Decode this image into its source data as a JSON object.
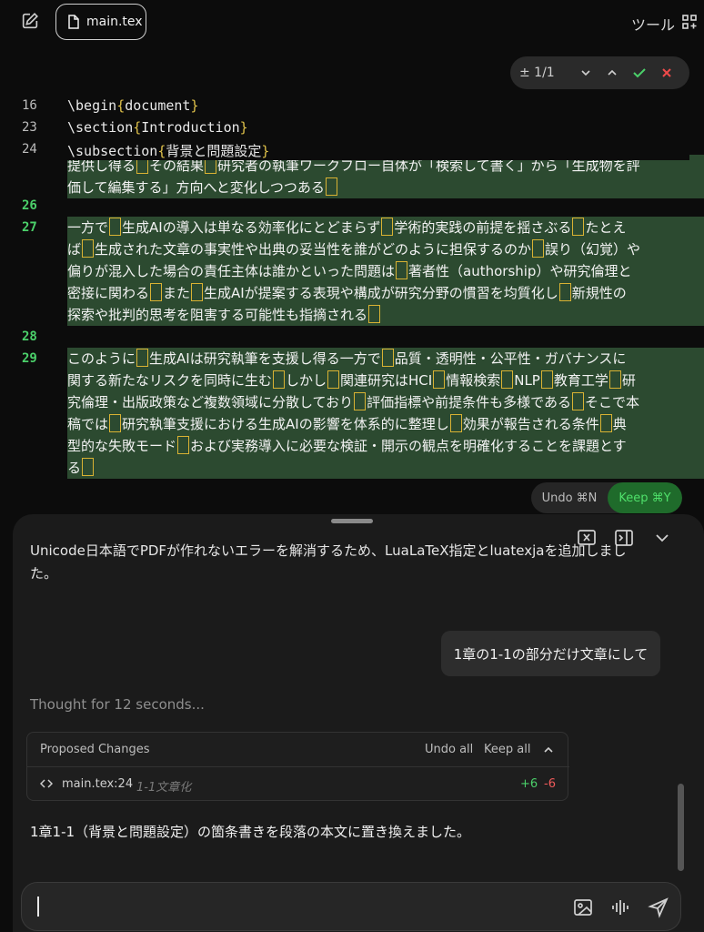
{
  "topbar": {
    "file_tab": "main.tex",
    "tools": "ツール"
  },
  "findbar": {
    "count": "± 1/1"
  },
  "editor": {
    "sticky": [
      {
        "num": "16",
        "cmd": "\\begin",
        "arg": "document"
      },
      {
        "num": "23",
        "cmd": "\\section",
        "arg": "Introduction"
      },
      {
        "num": "24",
        "cmd": "\\subsection",
        "arg": "背景と問題設定"
      }
    ],
    "gutter_green": [
      "26",
      "27",
      "28",
      "29"
    ],
    "block1": [
      [
        "提供し得る",
        "その結果",
        "研究者の執筆ワークフロー自体が「検索して書く」から「生成物を評"
      ],
      [
        "価して編集する」方向へと変化しつつある",
        ""
      ]
    ],
    "block2": [
      [
        "一方で",
        "生成AIの導入は単なる効率化にとどまらず",
        "学術的実践の前提を揺さぶる",
        "たとえ"
      ],
      [
        "ば",
        "生成された文章の事実性や出典の妥当性を誰がどのように担保するのか",
        "誤り（幻覚）や"
      ],
      [
        "偏りが混入した場合の責任主体は誰かといった問題は",
        "著者性（authorship）や研究倫理と"
      ],
      [
        "密接に関わる",
        "また",
        "生成AIが提案する表現や構成が研究分野の慣習を均質化し",
        "新規性の"
      ],
      [
        "探索や批判的思考を阻害する可能性も指摘される",
        ""
      ]
    ],
    "block3": [
      [
        "このように",
        "生成AIは研究執筆を支援し得る一方で",
        "品質・透明性・公平性・ガバナンスに"
      ],
      [
        "関する新たなリスクを同時に生む",
        "しかし",
        "関連研究はHCI",
        "情報検索",
        "NLP",
        "教育工学",
        "研"
      ],
      [
        "究倫理・出版政策など複数領域に分散しており",
        "評価指標や前提条件も多様である",
        "そこで本"
      ],
      [
        "稿では",
        "研究執筆支援における生成AIの影響を体系的に整理し",
        "効果が報告される条件",
        "典"
      ],
      [
        "型的な失敗モード",
        "および実務導入に必要な検証・開示の観点を明確化することを課題とす"
      ],
      [
        "る",
        ""
      ]
    ],
    "undo": "Undo ⌘N",
    "keep": "Keep ⌘Y"
  },
  "chat": {
    "prev_line1": "Unicode日本語でPDFが作れないエラーを解消するため、LuaLaTeX指定とluatexjaを追加しまし",
    "prev_line2": "た。",
    "user_message": "1章の1-1の部分だけ文章にして",
    "thought": "Thought for 12 seconds...",
    "changes": {
      "title": "Proposed Changes",
      "undo_all": "Undo all",
      "keep_all": "Keep all",
      "file": "main.tex:24",
      "desc": "1-1文章化",
      "added": "+6",
      "removed": "-6"
    },
    "answer": "1章1-1（背景と問題設定）の箇条書きを段落の本文に置き換えました。"
  }
}
